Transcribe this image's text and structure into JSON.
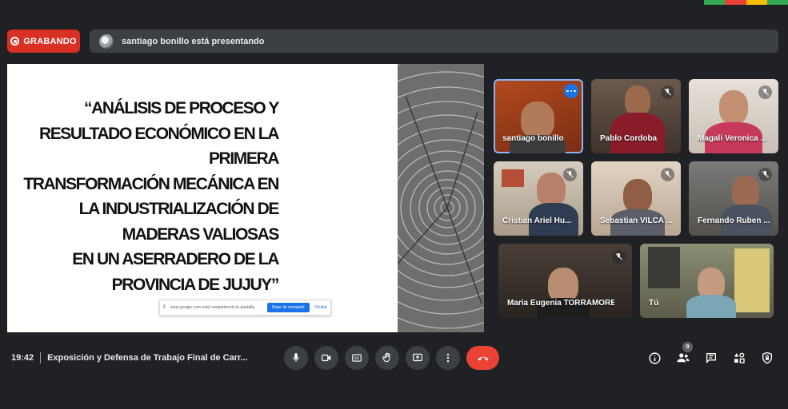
{
  "brand_colors": [
    "#34a853",
    "#ea4335",
    "#fbbc04",
    "#34a853"
  ],
  "recording": {
    "label": "GRABANDO",
    "color": "#d93025"
  },
  "presenting": {
    "text": "santiago bonillo está presentando"
  },
  "slide": {
    "title_lines": [
      "“ANÁLISIS DE PROCESO Y",
      "RESULTADO ECONÓMICO EN LA",
      "PRIMERA",
      "TRANSFORMACIÓN MECÁNICA EN",
      "LA INDUSTRIALIZACIÓN DE",
      "MADERAS VALIOSAS",
      "EN UN ASERRADERO DE LA",
      "PROVINCIA DE JUJUY”"
    ],
    "share_bar": {
      "message": "meet.google.com está compartiendo tu pantalla.",
      "stop_label": "Dejar de compartir",
      "hide_label": "Ocultar"
    }
  },
  "participants": [
    {
      "name": "santiago bonillo",
      "muted": false,
      "active": true
    },
    {
      "name": "Pablo Cordoba",
      "muted": true
    },
    {
      "name": "Magali Veronica ...",
      "muted": true
    },
    {
      "name": "Cristian Ariel Hu...",
      "muted": true
    },
    {
      "name": "Sebastian VILCA ...",
      "muted": true
    },
    {
      "name": "Fernando Ruben ...",
      "muted": true
    },
    {
      "name": "Maria Eugenia TORRAMORE...",
      "muted": true
    },
    {
      "name": "Tú",
      "muted": false
    }
  ],
  "bottom": {
    "time": "19:42",
    "meeting_title": "Exposición y Defensa de Trabajo Final de Carr...",
    "participant_count": "9"
  },
  "icons": {
    "mic": "mic-icon",
    "camera": "camera-icon",
    "captions": "captions-icon",
    "raise_hand": "raise-hand-icon",
    "present": "present-icon",
    "more": "more-vert-icon",
    "end_call": "end-call-icon",
    "info": "info-icon",
    "people": "people-icon",
    "chat": "chat-icon",
    "activities": "activities-icon",
    "host_controls": "shield-icon"
  },
  "colors": {
    "end_call": "#ea4335",
    "control_bg": "#3c4043",
    "active_border": "#8ab4f8"
  }
}
